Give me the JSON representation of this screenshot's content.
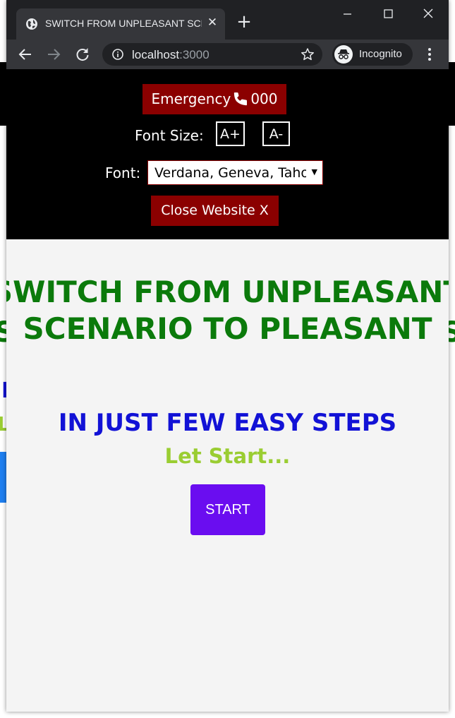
{
  "browser": {
    "tab_title": "SWITCH FROM UNPLEASANT SCENARIO TO PLEASANT",
    "url_host": "localhost",
    "url_port": ":3000",
    "profile_label": "Incognito",
    "icons": [
      "globe-icon",
      "close-icon",
      "plus-icon",
      "minimize-icon",
      "maximize-icon",
      "close-window-icon",
      "back-arrow-icon",
      "forward-arrow-icon",
      "reload-icon",
      "info-icon",
      "star-icon",
      "incognito-icon",
      "more-vert-icon"
    ]
  },
  "header": {
    "emergency_label": "Emergency",
    "emergency_number": "000",
    "font_size_label": "Font Size:",
    "increase_label": "A+",
    "decrease_label": "A-",
    "font_label": "Font:",
    "font_value": "Verdana, Geneva, Tahoma, sans-serif",
    "close_label": "Close Website X"
  },
  "hero": {
    "title": "SWITCH FROM UNPLEASANT SCENARIO TO PLEASANT",
    "subtitle": "IN JUST FEW EASY STEPS",
    "tagline": "Let Start...",
    "start_label": "START"
  },
  "colors": {
    "header_bg": "#000000",
    "danger": "#8b0000",
    "title": "#0b7a0b",
    "subtitle": "#1212d6",
    "tagline": "#9acd32",
    "start_button": "#6a0df0",
    "page_bg": "#f4f4f4"
  }
}
